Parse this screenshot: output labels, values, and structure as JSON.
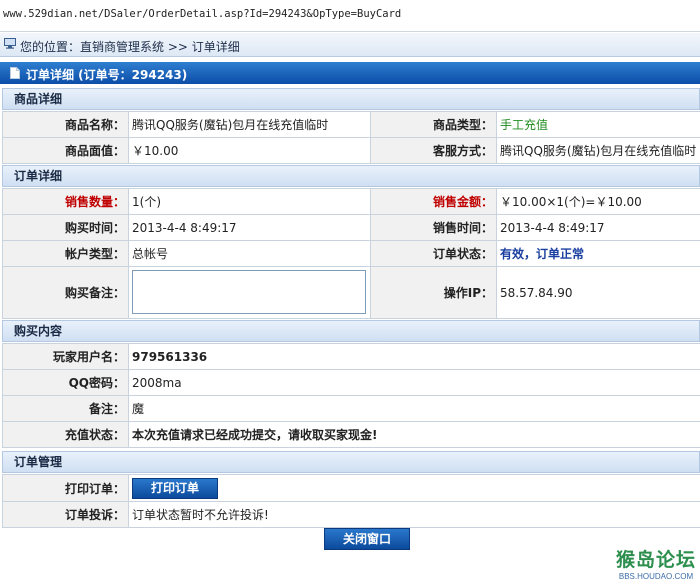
{
  "address_bar": {
    "url": "www.529dian.net/DSaler/OrderDetail.asp?Id=294243&OpType=BuyCard"
  },
  "location": {
    "text": "您的位置：直销商管理系统 >> 订单详细"
  },
  "header": {
    "title": "订单详细 (订单号：294243)"
  },
  "product": {
    "section": "商品详细",
    "name_label": "商品名称：",
    "name_value": "腾讯QQ服务(魔钻)包月在线充值临时",
    "type_label": "商品类型：",
    "type_value": "手工充值",
    "face_label": "商品面值：",
    "face_value": "￥10.00",
    "service_label": "客服方式：",
    "service_value": "腾讯QQ服务(魔钻)包月在线充值临时"
  },
  "order": {
    "section": "订单详细",
    "qty_label": "销售数量：",
    "qty_value": "1(个)",
    "amount_label": "销售金额：",
    "amount_value": "￥10.00×1(个)=￥10.00",
    "buy_time_label": "购买时间：",
    "buy_time_value": "2013-4-4 8:49:17",
    "sale_time_label": "销售时间：",
    "sale_time_value": "2013-4-4 8:49:17",
    "acct_type_label": "帐户类型：",
    "acct_type_value": "总帐号",
    "status_label": "订单状态：",
    "status_value": "有效，订单正常",
    "memo_label": "购买备注：",
    "memo_value": "",
    "ip_label": "操作IP：",
    "ip_value": "58.57.84.90"
  },
  "purchase": {
    "section": "购买内容",
    "user_label": "玩家用户名：",
    "user_value": "979561336",
    "pwd_label": "QQ密码：",
    "pwd_value": "2008ma",
    "note_label": "备注：",
    "note_value": "魔",
    "charge_label": "充值状态：",
    "charge_value": "本次充值请求已经成功提交，请收取买家现金!"
  },
  "manage": {
    "section": "订单管理",
    "print_label": "打印订单：",
    "print_button": "打印订单",
    "complain_label": "订单投诉：",
    "complain_value": "订单状态暂时不允许投诉!",
    "close_button": "关闭窗口"
  },
  "watermark": {
    "main": "猴岛论坛",
    "sub": "BBS.HOUDAO.COM"
  },
  "colors": {
    "header_blue": "#0b4da8",
    "green": "#1f8c1f",
    "red_label": "#c00000"
  }
}
